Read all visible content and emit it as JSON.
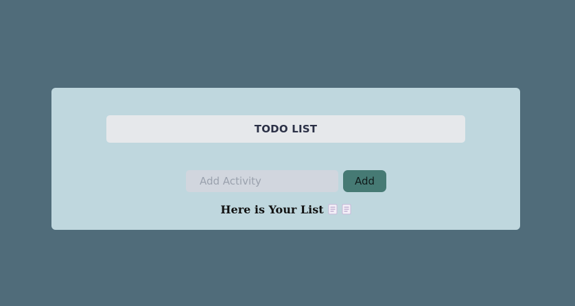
{
  "header": {
    "title": "TODO LIST"
  },
  "form": {
    "input_placeholder": "Add Activity",
    "input_value": "",
    "add_label": "Add"
  },
  "list": {
    "heading": "Here is Your List",
    "icons": [
      "page-icon",
      "page-icon"
    ]
  },
  "colors": {
    "background": "#506c7a",
    "card": "#bfd7de",
    "title_bar": "#e6e8eb",
    "input": "#d1d6de",
    "button": "#467a74"
  }
}
